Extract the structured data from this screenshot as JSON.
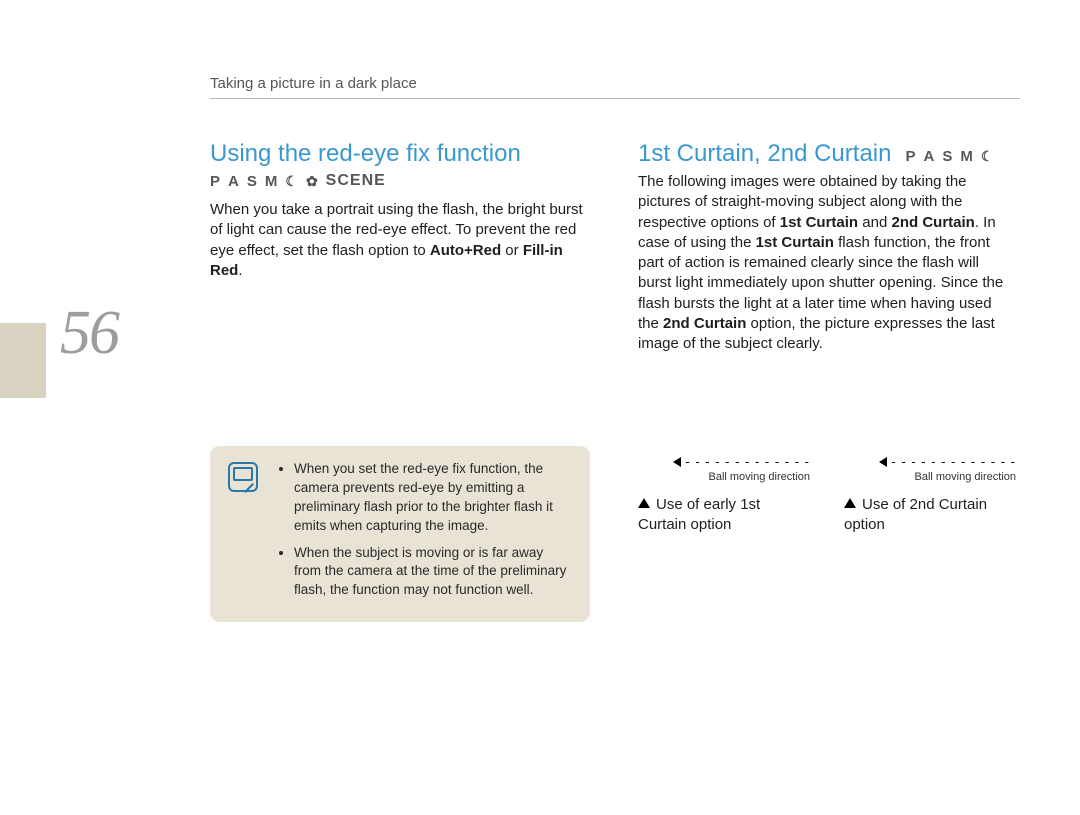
{
  "header": "Taking a picture in a dark place",
  "page_number": "56",
  "left": {
    "title": "Using the red-eye fix function",
    "modes": {
      "p": "P",
      "a": "A",
      "s": "S",
      "m": "M",
      "scene": "SCENE"
    },
    "body_pre": "When you take a portrait using the flash, the bright burst of light can cause the red-eye effect. To prevent the red eye effect, set the flash option to ",
    "body_b1": "Auto+Red",
    "body_mid": " or ",
    "body_b2": "Fill-in Red",
    "body_post": ".",
    "note_items": [
      "When you set the red-eye fix function, the camera prevents red-eye by emitting a preliminary flash prior to the brighter flash it emits when capturing the image.",
      "When the subject is moving or is far away from the camera at the time of the preliminary flash, the function may not function well."
    ]
  },
  "right": {
    "title": "1st Curtain, 2nd Curtain",
    "modes": {
      "p": "P",
      "a": "A",
      "s": "S",
      "m": "M"
    },
    "body_pre1": "The following images were obtained by taking the pictures of straight-moving subject along with the respective options of ",
    "body_b1": "1st Curtain",
    "body_mid1": " and ",
    "body_b2": "2nd Curtain",
    "body_mid2": ". In case of using the ",
    "body_b3": "1st Curtain",
    "body_mid3": " flash function, the front part of action is remained clearly since the flash will burst light immediately upon shutter opening. Since the flash bursts the light at a later time when having used the ",
    "body_b4": "2nd Curtain",
    "body_post": " option, the picture expresses the last image of the subject clearly.",
    "figures": [
      {
        "dir_label": "Ball moving direction",
        "caption": "Use of early 1st Curtain option"
      },
      {
        "dir_label": "Ball moving direction",
        "caption": "Use of 2nd Curtain option"
      }
    ]
  }
}
